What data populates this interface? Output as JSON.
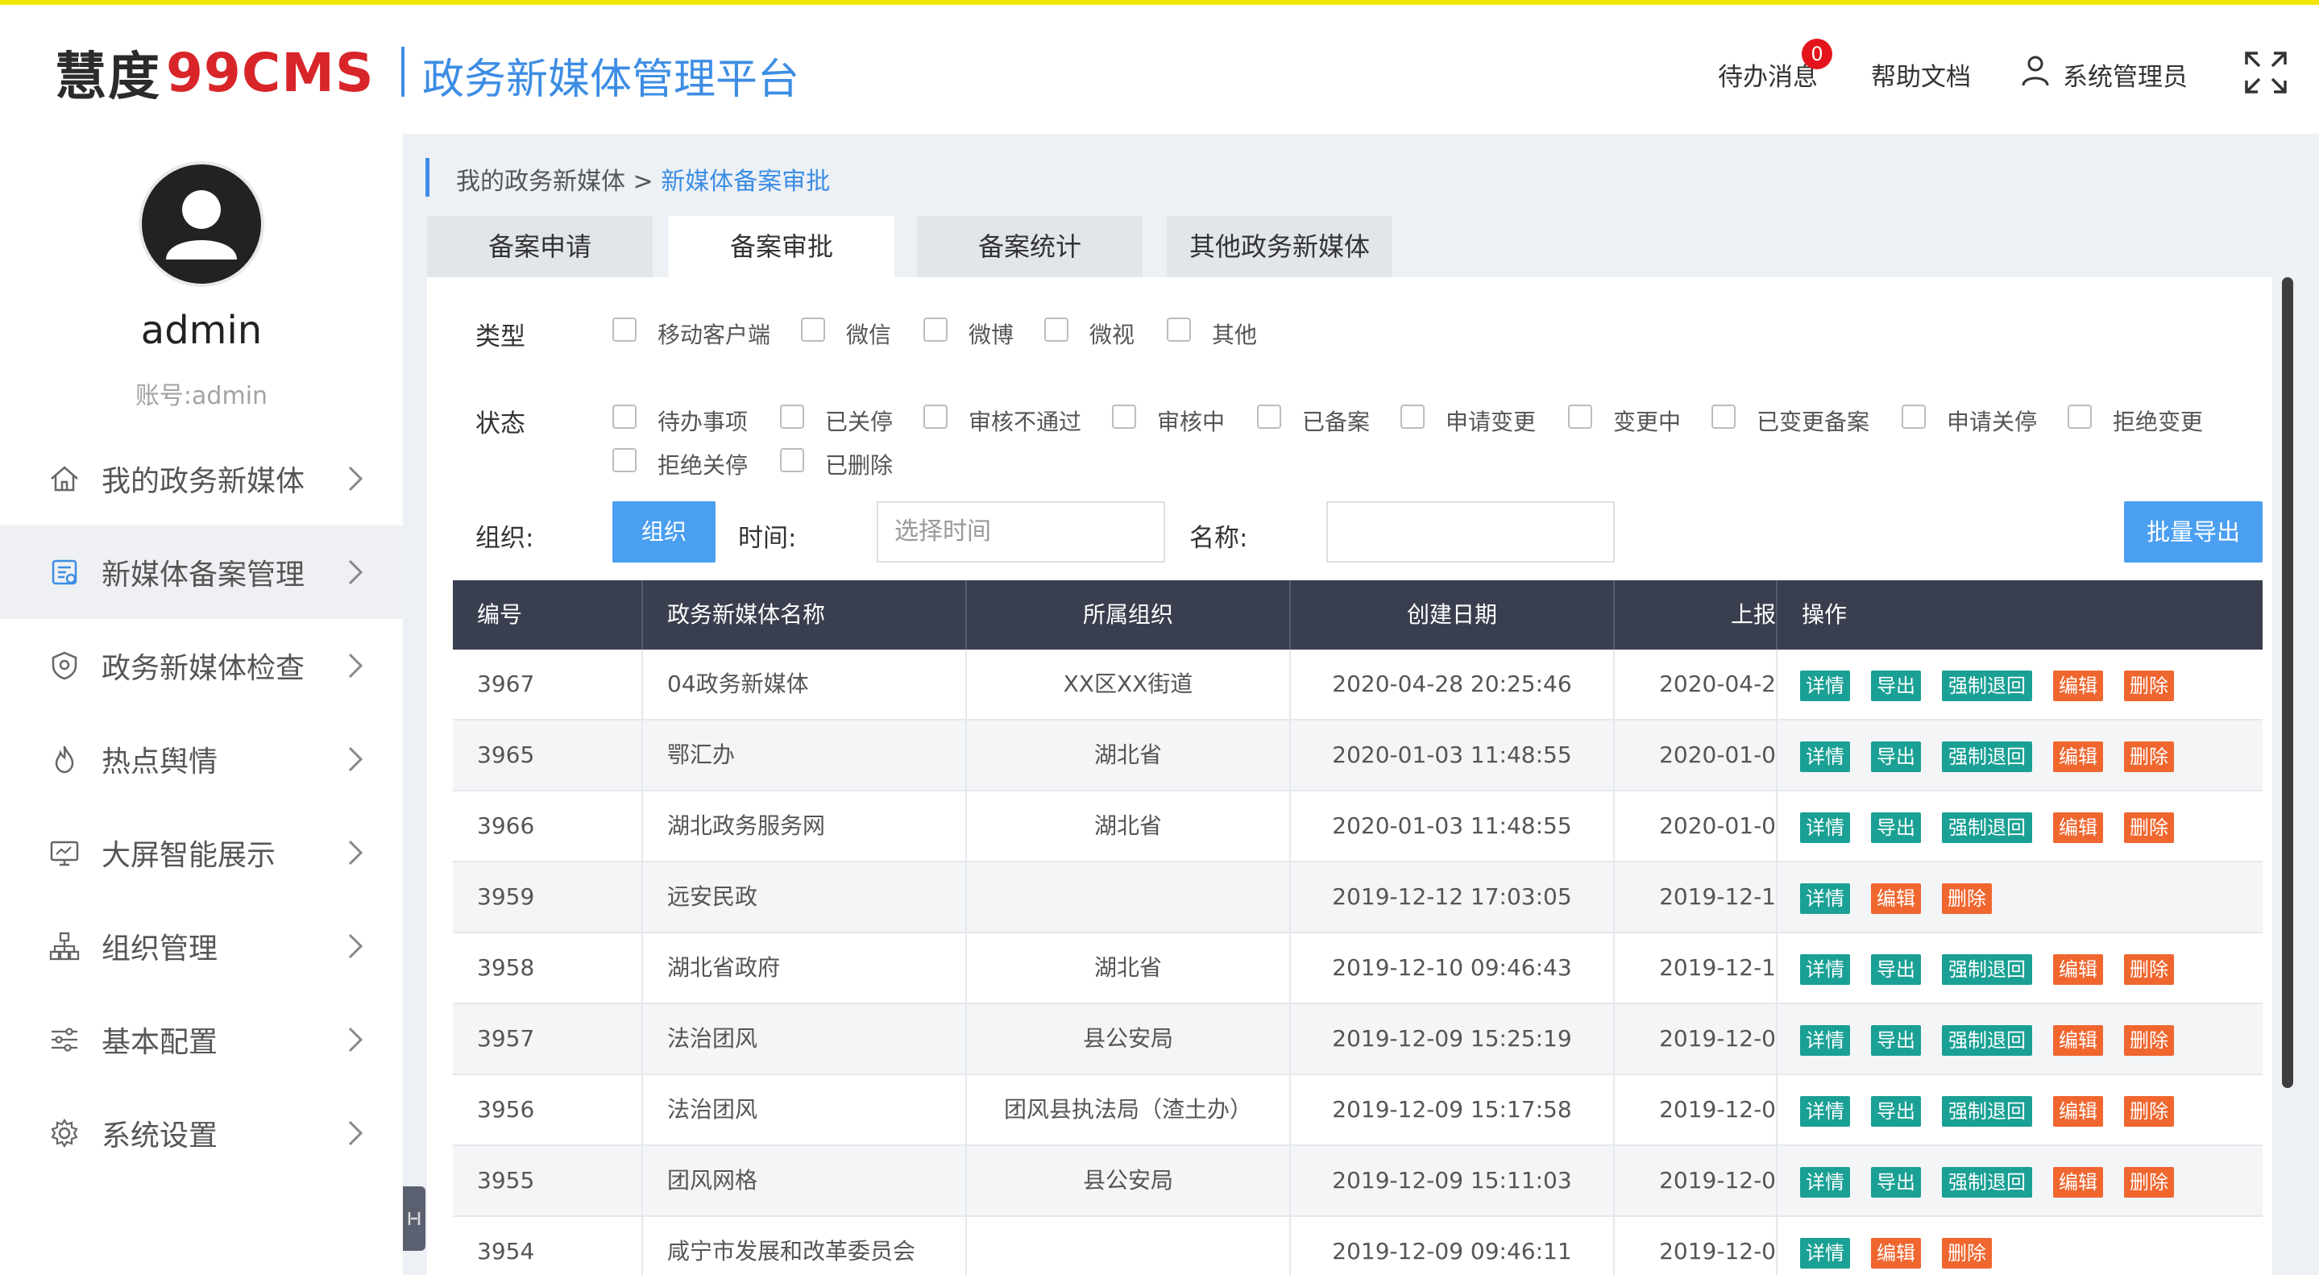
{
  "header": {
    "logo_cn": "慧度",
    "logo_en": "99CMS",
    "platform_title": "政务新媒体管理平台",
    "todo_label": "待办消息",
    "todo_count": "0",
    "help_label": "帮助文档",
    "user_label": "系统管理员"
  },
  "sidebar": {
    "username": "admin",
    "account": "账号:admin",
    "items": [
      {
        "label": "我的政务新媒体",
        "icon": "home-icon"
      },
      {
        "label": "新媒体备案管理",
        "icon": "record-icon",
        "active": true
      },
      {
        "label": "政务新媒体检查",
        "icon": "shield-icon"
      },
      {
        "label": "热点舆情",
        "icon": "flame-icon"
      },
      {
        "label": "大屏智能展示",
        "icon": "monitor-icon"
      },
      {
        "label": "组织管理",
        "icon": "org-icon"
      },
      {
        "label": "基本配置",
        "icon": "sliders-icon"
      },
      {
        "label": "系统设置",
        "icon": "gear-icon"
      }
    ]
  },
  "breadcrumb": {
    "parent": "我的政务新媒体",
    "separator": " > ",
    "current": "新媒体备案审批"
  },
  "tabs": [
    {
      "label": "备案申请"
    },
    {
      "label": "备案审批",
      "active": true
    },
    {
      "label": "备案统计"
    },
    {
      "label": "其他政务新媒体"
    }
  ],
  "filters": {
    "type_label": "类型",
    "types": [
      "移动客户端",
      "微信",
      "微博",
      "微视",
      "其他"
    ],
    "status_label": "状态",
    "statuses": [
      "待办事项",
      "已关停",
      "审核不通过",
      "审核中",
      "已备案",
      "申请变更",
      "变更中",
      "已变更备案",
      "申请关停",
      "拒绝变更",
      "拒绝关停",
      "已删除"
    ],
    "org_label": "组织:",
    "org_button": "组织",
    "time_label": "时间:",
    "time_placeholder": "选择时间",
    "name_label": "名称:",
    "name_value": "",
    "export_button": "批量导出"
  },
  "table": {
    "columns": [
      "编号",
      "政务新媒体名称",
      "所属组织",
      "创建日期",
      "上报",
      "操作"
    ],
    "rows": [
      {
        "id": "3967",
        "name": "04政务新媒体",
        "org": "XX区XX街道",
        "created": "2020-04-28 20:25:46",
        "reported": "2020-04-2",
        "actions": [
          "详情",
          "导出",
          "强制退回",
          "编辑",
          "删除"
        ]
      },
      {
        "id": "3965",
        "name": "鄂汇办",
        "org": "湖北省",
        "created": "2020-01-03 11:48:55",
        "reported": "2020-01-0",
        "actions": [
          "详情",
          "导出",
          "强制退回",
          "编辑",
          "删除"
        ]
      },
      {
        "id": "3966",
        "name": "湖北政务服务网",
        "org": "湖北省",
        "created": "2020-01-03 11:48:55",
        "reported": "2020-01-0",
        "actions": [
          "详情",
          "导出",
          "强制退回",
          "编辑",
          "删除"
        ]
      },
      {
        "id": "3959",
        "name": "远安民政",
        "org": "",
        "created": "2019-12-12 17:03:05",
        "reported": "2019-12-1",
        "actions": [
          "详情",
          "编辑",
          "删除"
        ]
      },
      {
        "id": "3958",
        "name": "湖北省政府",
        "org": "湖北省",
        "created": "2019-12-10 09:46:43",
        "reported": "2019-12-1",
        "actions": [
          "详情",
          "导出",
          "强制退回",
          "编辑",
          "删除"
        ]
      },
      {
        "id": "3957",
        "name": "法治团风",
        "org": "县公安局",
        "created": "2019-12-09 15:25:19",
        "reported": "2019-12-0",
        "actions": [
          "详情",
          "导出",
          "强制退回",
          "编辑",
          "删除"
        ]
      },
      {
        "id": "3956",
        "name": "法治团风",
        "org": "团风县执法局（渣土办）",
        "created": "2019-12-09 15:17:58",
        "reported": "2019-12-0",
        "actions": [
          "详情",
          "导出",
          "强制退回",
          "编辑",
          "删除"
        ]
      },
      {
        "id": "3955",
        "name": "团风网格",
        "org": "县公安局",
        "created": "2019-12-09 15:11:03",
        "reported": "2019-12-0",
        "actions": [
          "详情",
          "导出",
          "强制退回",
          "编辑",
          "删除"
        ]
      },
      {
        "id": "3954",
        "name": "咸宁市发展和改革委员会",
        "org": "",
        "created": "2019-12-09 09:46:11",
        "reported": "2019-12-0",
        "actions": [
          "详情",
          "编辑",
          "删除"
        ]
      }
    ]
  },
  "colors": {
    "accent": "#3d8de4",
    "teal": "#1aa094",
    "orange": "#f0662f",
    "header_dark": "#3a3f4f",
    "logo_red": "#d8252a"
  }
}
